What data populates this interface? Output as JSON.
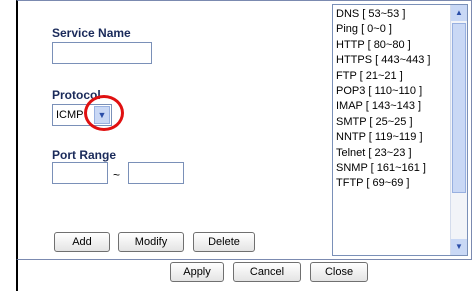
{
  "form": {
    "service_name_label": "Service Name",
    "service_name_value": "",
    "protocol_label": "Protocol",
    "protocol_selected": "ICMP",
    "port_range_label": "Port Range",
    "port_from_value": "",
    "port_range_separator": "~",
    "port_to_value": "",
    "add_label": "Add",
    "modify_label": "Modify",
    "delete_label": "Delete"
  },
  "service_list": {
    "items": [
      "DNS [ 53~53 ]",
      "Ping [ 0~0 ]",
      "HTTP [ 80~80 ]",
      "HTTPS [ 443~443 ]",
      "FTP [ 21~21 ]",
      "POP3 [ 110~110 ]",
      "IMAP [ 143~143 ]",
      "SMTP [ 25~25 ]",
      "NNTP [ 119~119 ]",
      "Telnet [ 23~23 ]",
      "SNMP [ 161~161 ]",
      "TFTP [ 69~69 ]"
    ]
  },
  "footer": {
    "apply_label": "Apply",
    "cancel_label": "Cancel",
    "close_label": "Close"
  },
  "icons": {
    "select_arrow": "chevron-down-icon",
    "scroll_up": "chevron-up-icon",
    "scroll_down": "chevron-down-icon"
  },
  "colors": {
    "label_text": "#1a2a5a",
    "annotation": "#e01010",
    "border": "#7a90b8"
  }
}
